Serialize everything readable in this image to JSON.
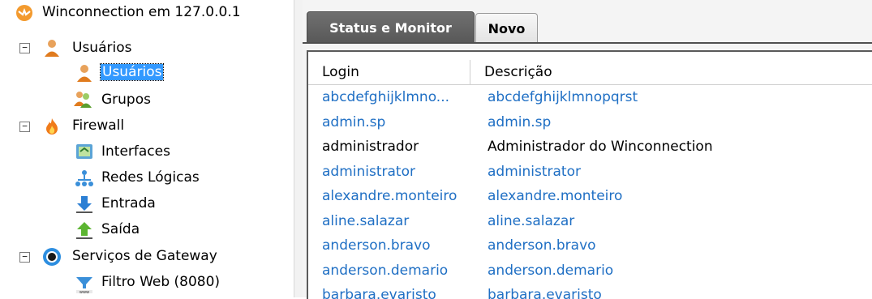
{
  "tree": {
    "root": "Winconnection em 127.0.0.1",
    "usuarios_group": "Usuários",
    "usuarios_item": "Usuários",
    "grupos": "Grupos",
    "firewall": "Firewall",
    "interfaces": "Interfaces",
    "redes_logicas": "Redes Lógicas",
    "entrada": "Entrada",
    "saida": "Saída",
    "servicos": "Serviços de Gateway",
    "filtro_web": "Filtro Web (8080)",
    "expander_symbol": "−"
  },
  "tabs": {
    "status": "Status e Monitor",
    "novo": "Novo"
  },
  "grid": {
    "columns": [
      "Login",
      "Descrição"
    ],
    "rows": [
      {
        "login": "abcdefghijklmno...",
        "desc": "abcdefghijklmnopqrst"
      },
      {
        "login": "admin.sp",
        "desc": "admin.sp"
      },
      {
        "login": "administrador",
        "desc": "Administrador do Winconnection"
      },
      {
        "login": "administrator",
        "desc": "administrator"
      },
      {
        "login": "alexandre.monteiro",
        "desc": "alexandre.monteiro"
      },
      {
        "login": "aline.salazar",
        "desc": "aline.salazar"
      },
      {
        "login": "anderson.bravo",
        "desc": "anderson.bravo"
      },
      {
        "login": "anderson.demario",
        "desc": "anderson.demario"
      },
      {
        "login": "barbara.evaristo",
        "desc": "barbara.evaristo"
      }
    ]
  },
  "colors": {
    "link_blue": "#1f6fc4",
    "selection": "#3399ff",
    "active_tab": "#606060"
  }
}
